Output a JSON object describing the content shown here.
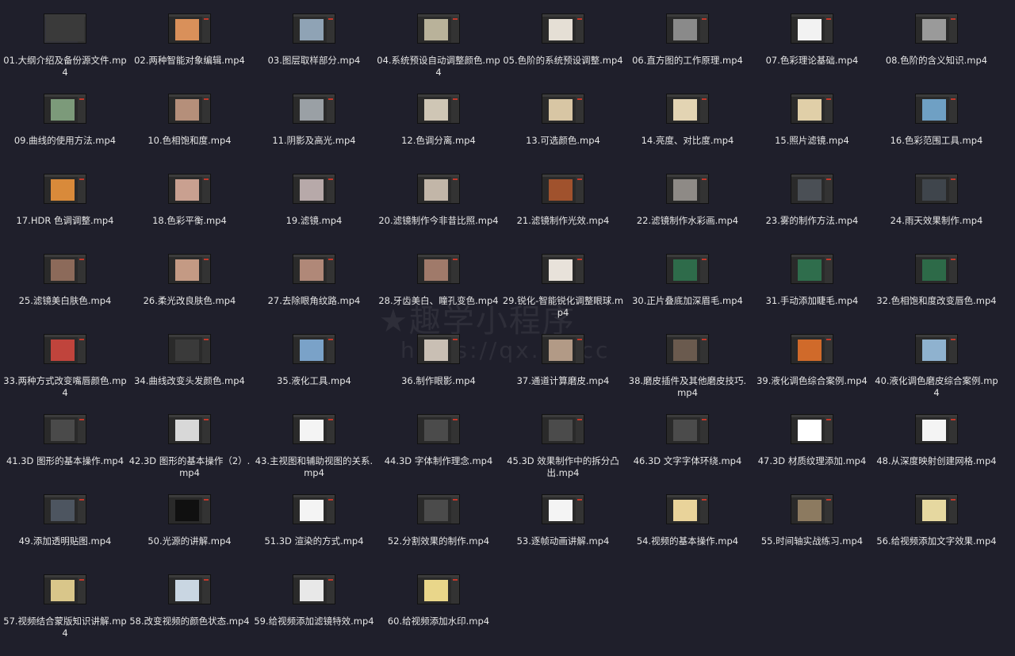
{
  "watermark": {
    "title": "★趣学小程序",
    "url": "https://qx.cn.cc"
  },
  "files": [
    {
      "name": "01.大纲介绍及备份源文件.mp4",
      "thumb": "#3a3a3a"
    },
    {
      "name": "02.两种智能对象编辑.mp4",
      "thumb": "#d9905a"
    },
    {
      "name": "03.图层取样部分.mp4",
      "thumb": "#8fa3b5"
    },
    {
      "name": "04.系统预设自动调整颜色.mp4",
      "thumb": "#b9b29a"
    },
    {
      "name": "05.色阶的系统预设调整.mp4",
      "thumb": "#e5dfd5"
    },
    {
      "name": "06.直方图的工作原理.mp4",
      "thumb": "#8a8a8a"
    },
    {
      "name": "07.色彩理论基础.mp4",
      "thumb": "#f2f2f2"
    },
    {
      "name": "08.色阶的含义知识.mp4",
      "thumb": "#9a9a9a"
    },
    {
      "name": "09.曲线的使用方法.mp4",
      "thumb": "#7c9a7a"
    },
    {
      "name": "10.色相饱和度.mp4",
      "thumb": "#b58f7a"
    },
    {
      "name": "11.阴影及高光.mp4",
      "thumb": "#9aa0a5"
    },
    {
      "name": "12.色调分离.mp4",
      "thumb": "#cfc6b5"
    },
    {
      "name": "13.可选颜色.mp4",
      "thumb": "#d8c6a4"
    },
    {
      "name": "14.亮度、对比度.mp4",
      "thumb": "#e3d4b3"
    },
    {
      "name": "15.照片滤镜.mp4",
      "thumb": "#e0cfa8"
    },
    {
      "name": "16.色彩范围工具.mp4",
      "thumb": "#6fa0c4"
    },
    {
      "name": "17.HDR 色调调整.mp4",
      "thumb": "#d98a3a"
    },
    {
      "name": "18.色彩平衡.mp4",
      "thumb": "#c9a090"
    },
    {
      "name": "19.滤镜.mp4",
      "thumb": "#b7a9a9"
    },
    {
      "name": "20.滤镜制作今非昔比照.mp4",
      "thumb": "#c2b6a8"
    },
    {
      "name": "21.滤镜制作光效.mp4",
      "thumb": "#a0522d"
    },
    {
      "name": "22.滤镜制作水彩画.mp4",
      "thumb": "#8e8a86"
    },
    {
      "name": "23.雾的制作方法.mp4",
      "thumb": "#4a4f55"
    },
    {
      "name": "24.雨天效果制作.mp4",
      "thumb": "#3f454c"
    },
    {
      "name": "25.滤镜美白肤色.mp4",
      "thumb": "#8c6a5a"
    },
    {
      "name": "26.柔光改良肤色.mp4",
      "thumb": "#c49a84"
    },
    {
      "name": "27.去除眼角纹路.mp4",
      "thumb": "#b08878"
    },
    {
      "name": "28.牙齿美白、瞳孔变色.mp4",
      "thumb": "#a07a6a"
    },
    {
      "name": "29.锐化-智能锐化调整眼球.mp4",
      "thumb": "#e8e2da"
    },
    {
      "name": "30.正片叠底加深眉毛.mp4",
      "thumb": "#2e6b4a"
    },
    {
      "name": "31.手动添加睫毛.mp4",
      "thumb": "#2f6d4c"
    },
    {
      "name": "32.色相饱和度改变唇色.mp4",
      "thumb": "#2d6a48"
    },
    {
      "name": "33.两种方式改变嘴唇颜色.mp4",
      "thumb": "#c0443c"
    },
    {
      "name": "34.曲线改变头发颜色.mp4",
      "thumb": "#3a3a3a"
    },
    {
      "name": "35.液化工具.mp4",
      "thumb": "#7aa2c8"
    },
    {
      "name": "36.制作眼影.mp4",
      "thumb": "#c9bfb4"
    },
    {
      "name": "37.通道计算磨皮.mp4",
      "thumb": "#b29a86"
    },
    {
      "name": "38.磨皮插件及其他磨皮技巧.mp4",
      "thumb": "#6a5a4e"
    },
    {
      "name": "39.液化调色综合案例.mp4",
      "thumb": "#d06a2a"
    },
    {
      "name": "40.液化调色磨皮综合案例.mp4",
      "thumb": "#8fb2cf"
    },
    {
      "name": "41.3D 图形的基本操作.mp4",
      "thumb": "#4a4a4a"
    },
    {
      "name": "42.3D 图形的基本操作（2）.mp4",
      "thumb": "#d8d8d8"
    },
    {
      "name": "43.主视图和辅助视图的关系.mp4",
      "thumb": "#f4f4f4"
    },
    {
      "name": "44.3D 字体制作理念.mp4",
      "thumb": "#4b4b4b"
    },
    {
      "name": "45.3D 效果制作中的拆分凸出.mp4",
      "thumb": "#4b4b4b"
    },
    {
      "name": "46.3D 文字字体环绕.mp4",
      "thumb": "#4b4b4b"
    },
    {
      "name": "47.3D 材质纹理添加.mp4",
      "thumb": "#ffffff"
    },
    {
      "name": "48.从深度映射创建网格.mp4",
      "thumb": "#f4f4f4"
    },
    {
      "name": "49.添加透明贴图.mp4",
      "thumb": "#4d5560"
    },
    {
      "name": "50.光源的讲解.mp4",
      "thumb": "#101010"
    },
    {
      "name": "51.3D 渲染的方式.mp4",
      "thumb": "#f4f4f4"
    },
    {
      "name": "52.分割效果的制作.mp4",
      "thumb": "#4b4b4b"
    },
    {
      "name": "53.逐帧动画讲解.mp4",
      "thumb": "#f4f4f4"
    },
    {
      "name": "54.视频的基本操作.mp4",
      "thumb": "#e9d39a"
    },
    {
      "name": "55.时间轴实战练习.mp4",
      "thumb": "#8c7a60"
    },
    {
      "name": "56.给视频添加文字效果.mp4",
      "thumb": "#e6d8a0"
    },
    {
      "name": "57.视频结合蒙版知识讲解.mp4",
      "thumb": "#d9c68a"
    },
    {
      "name": "58.改变视频的颜色状态.mp4",
      "thumb": "#c9d6e2"
    },
    {
      "name": "59.给视频添加滤镜特效.mp4",
      "thumb": "#e8e8e8"
    },
    {
      "name": "60.给视频添加水印.mp4",
      "thumb": "#e9d68a"
    }
  ]
}
